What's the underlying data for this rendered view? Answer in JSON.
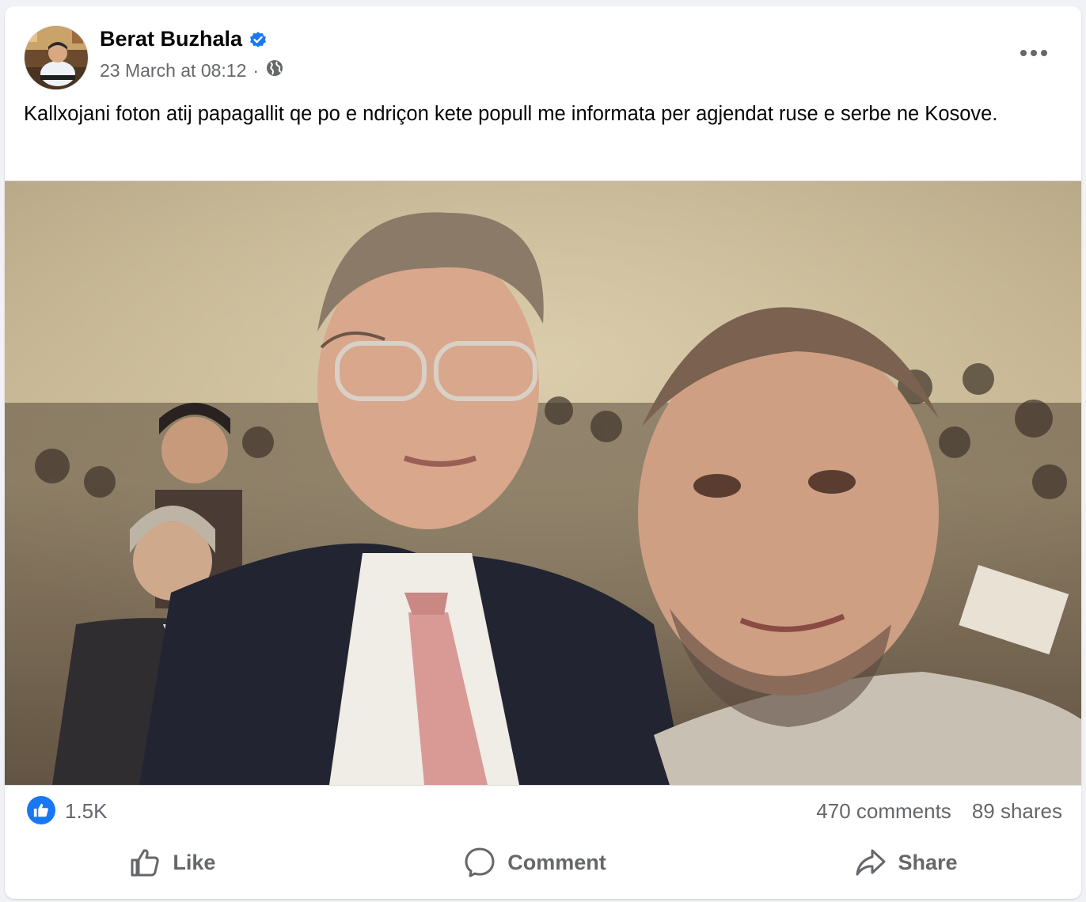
{
  "post": {
    "author": "Berat Buzhala",
    "verified": true,
    "timestamp": "23 March at 08:12",
    "separator": "·",
    "audience_icon": "globe-icon",
    "text": "Kallxojani foton atij papagallit qe po e ndriçon kete popull me informata per agjendat ruse e serbe ne Kosove."
  },
  "stats": {
    "likes": "1.5K",
    "comments": "470 comments",
    "shares": "89 shares"
  },
  "actions": {
    "like": "Like",
    "comment": "Comment",
    "share": "Share"
  },
  "colors": {
    "brand_blue": "#1877f2",
    "secondary_text": "#65676b",
    "primary_text": "#050505"
  }
}
